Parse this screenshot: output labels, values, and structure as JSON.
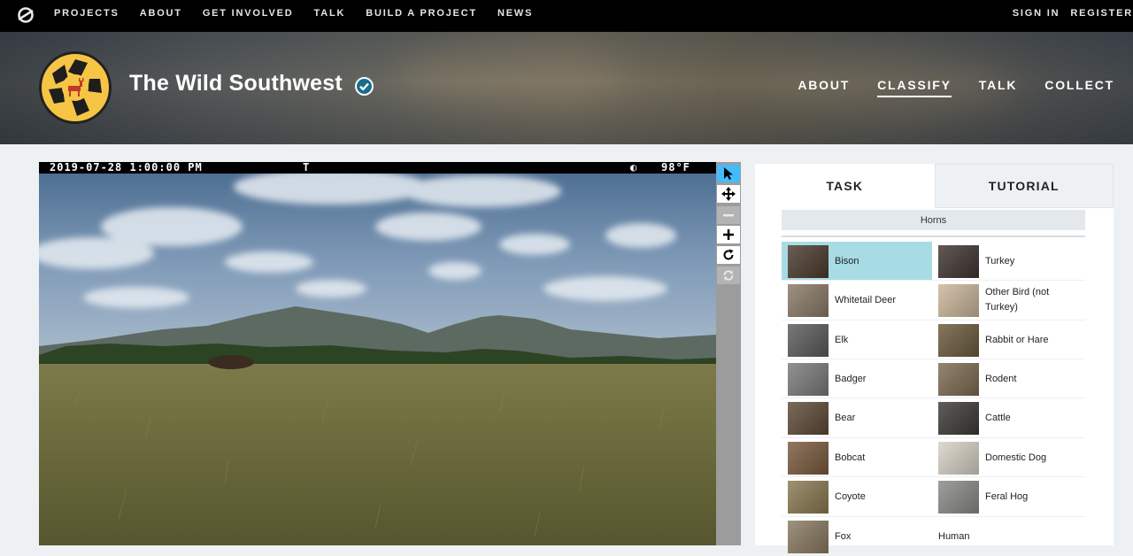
{
  "topnav": {
    "logo_icon": "zooniverse-logo-icon",
    "links": [
      "PROJECTS",
      "ABOUT",
      "GET INVOLVED",
      "TALK",
      "BUILD A PROJECT",
      "NEWS"
    ],
    "right": [
      "SIGN IN",
      "REGISTER"
    ]
  },
  "project": {
    "title": "The Wild Southwest",
    "logo_icon": "deer-camera-logo-icon",
    "verified_icon": "verified-check-icon",
    "nav": [
      "ABOUT",
      "CLASSIFY",
      "TALK",
      "COLLECT"
    ],
    "active_nav": "CLASSIFY"
  },
  "subject": {
    "datetime": "2019-07-28 1:00:00 PM",
    "marker": "T",
    "moon_icon": "moon-phase-icon",
    "temperature": "98°F"
  },
  "toolbar": {
    "tools": [
      "pointer-icon",
      "move-icon",
      "zoom-out-icon",
      "zoom-in-icon",
      "rotate-icon",
      "reset-icon"
    ]
  },
  "task": {
    "tabs": [
      "TASK",
      "TUTORIAL"
    ],
    "filter_label": "Horns",
    "choices": [
      {
        "label": "Bison",
        "selected": true,
        "color": "#4a3a2e"
      },
      {
        "label": "Turkey",
        "selected": false,
        "color": "#3e3530"
      },
      {
        "label": "Whitetail Deer",
        "selected": false,
        "color": "#8a7a66"
      },
      {
        "label": "Other Bird (not Turkey)",
        "selected": false,
        "color": "#cbb79a"
      },
      {
        "label": "Elk",
        "selected": false,
        "color": "#5b5b5b"
      },
      {
        "label": "Rabbit or Hare",
        "selected": false,
        "color": "#6b5a3c"
      },
      {
        "label": "Badger",
        "selected": false,
        "color": "#7a7a7a"
      },
      {
        "label": "Rodent",
        "selected": false,
        "color": "#7d6b52"
      },
      {
        "label": "Bear",
        "selected": false,
        "color": "#5e4a36"
      },
      {
        "label": "Cattle",
        "selected": false,
        "color": "#3c3a36"
      },
      {
        "label": "Bobcat",
        "selected": false,
        "color": "#7a5a3e"
      },
      {
        "label": "Domestic Dog",
        "selected": false,
        "color": "#d8d2c6"
      },
      {
        "label": "Coyote",
        "selected": false,
        "color": "#8a7a52"
      },
      {
        "label": "Feral Hog",
        "selected": false,
        "color": "#8a8a88"
      },
      {
        "label": "Fox",
        "selected": false,
        "color": "#8a7a62"
      },
      {
        "label": "Human",
        "selected": false,
        "color": ""
      }
    ]
  }
}
